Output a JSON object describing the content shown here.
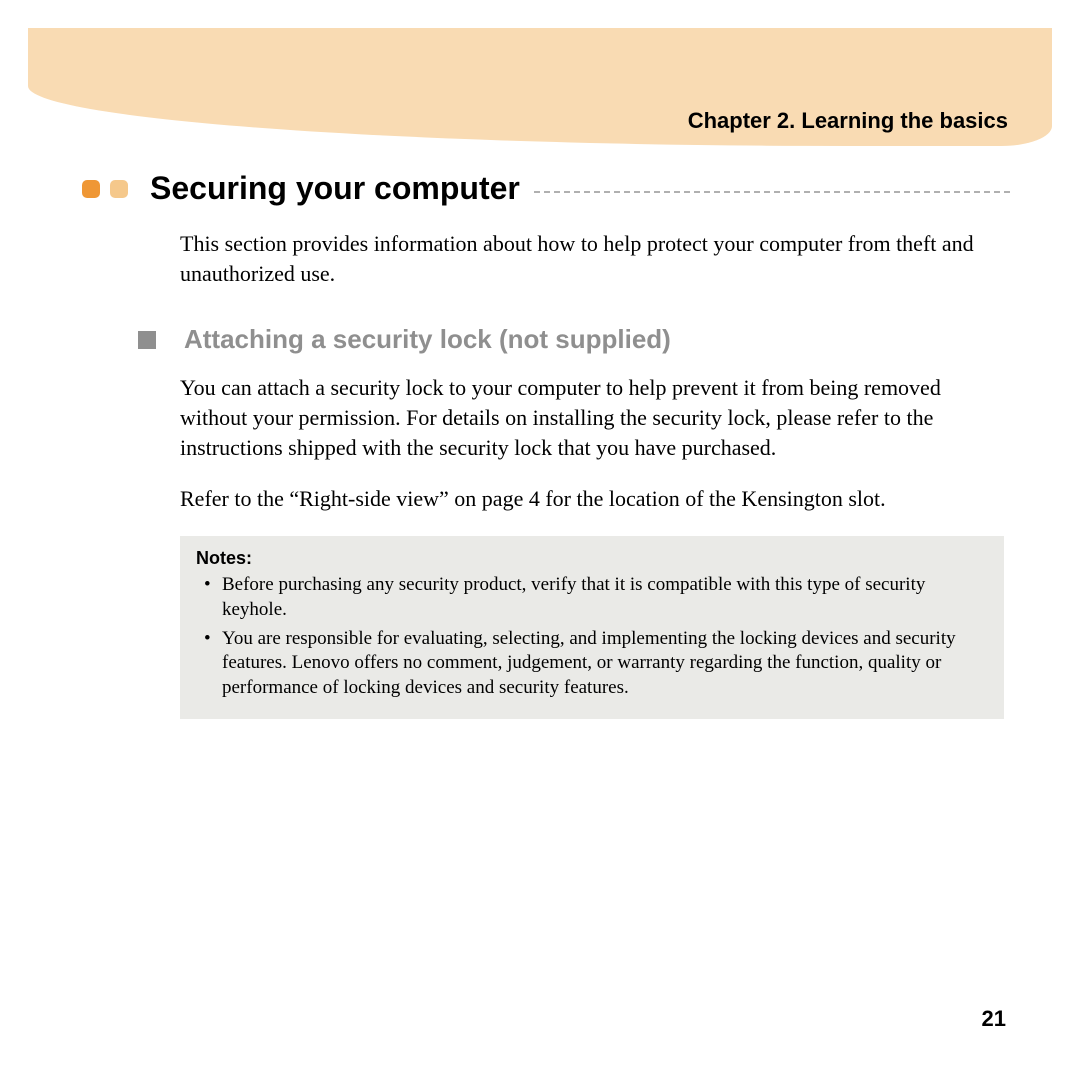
{
  "chapter": "Chapter 2. Learning the basics",
  "heading": "Securing your computer",
  "intro": "This section provides information about how to help protect your computer from theft and unauthorized use.",
  "subheading": "Attaching a security lock (not supplied)",
  "para1": "You can attach a security lock to your computer to help prevent it from being removed without your permission. For details on installing the security lock, please refer to the instructions shipped with the security lock that you have purchased.",
  "para2": "Refer to the “Right-side view” on page 4 for the location of the Kensington slot.",
  "notes_label": "Notes:",
  "notes": [
    "Before purchasing any security product, verify that it is compatible with this type of security keyhole.",
    "You are responsible for evaluating, selecting, and implementing the locking devices and security features. Lenovo offers no comment, judgement, or warranty regarding the function, quality or performance of locking devices and security features."
  ],
  "page_number": "21"
}
